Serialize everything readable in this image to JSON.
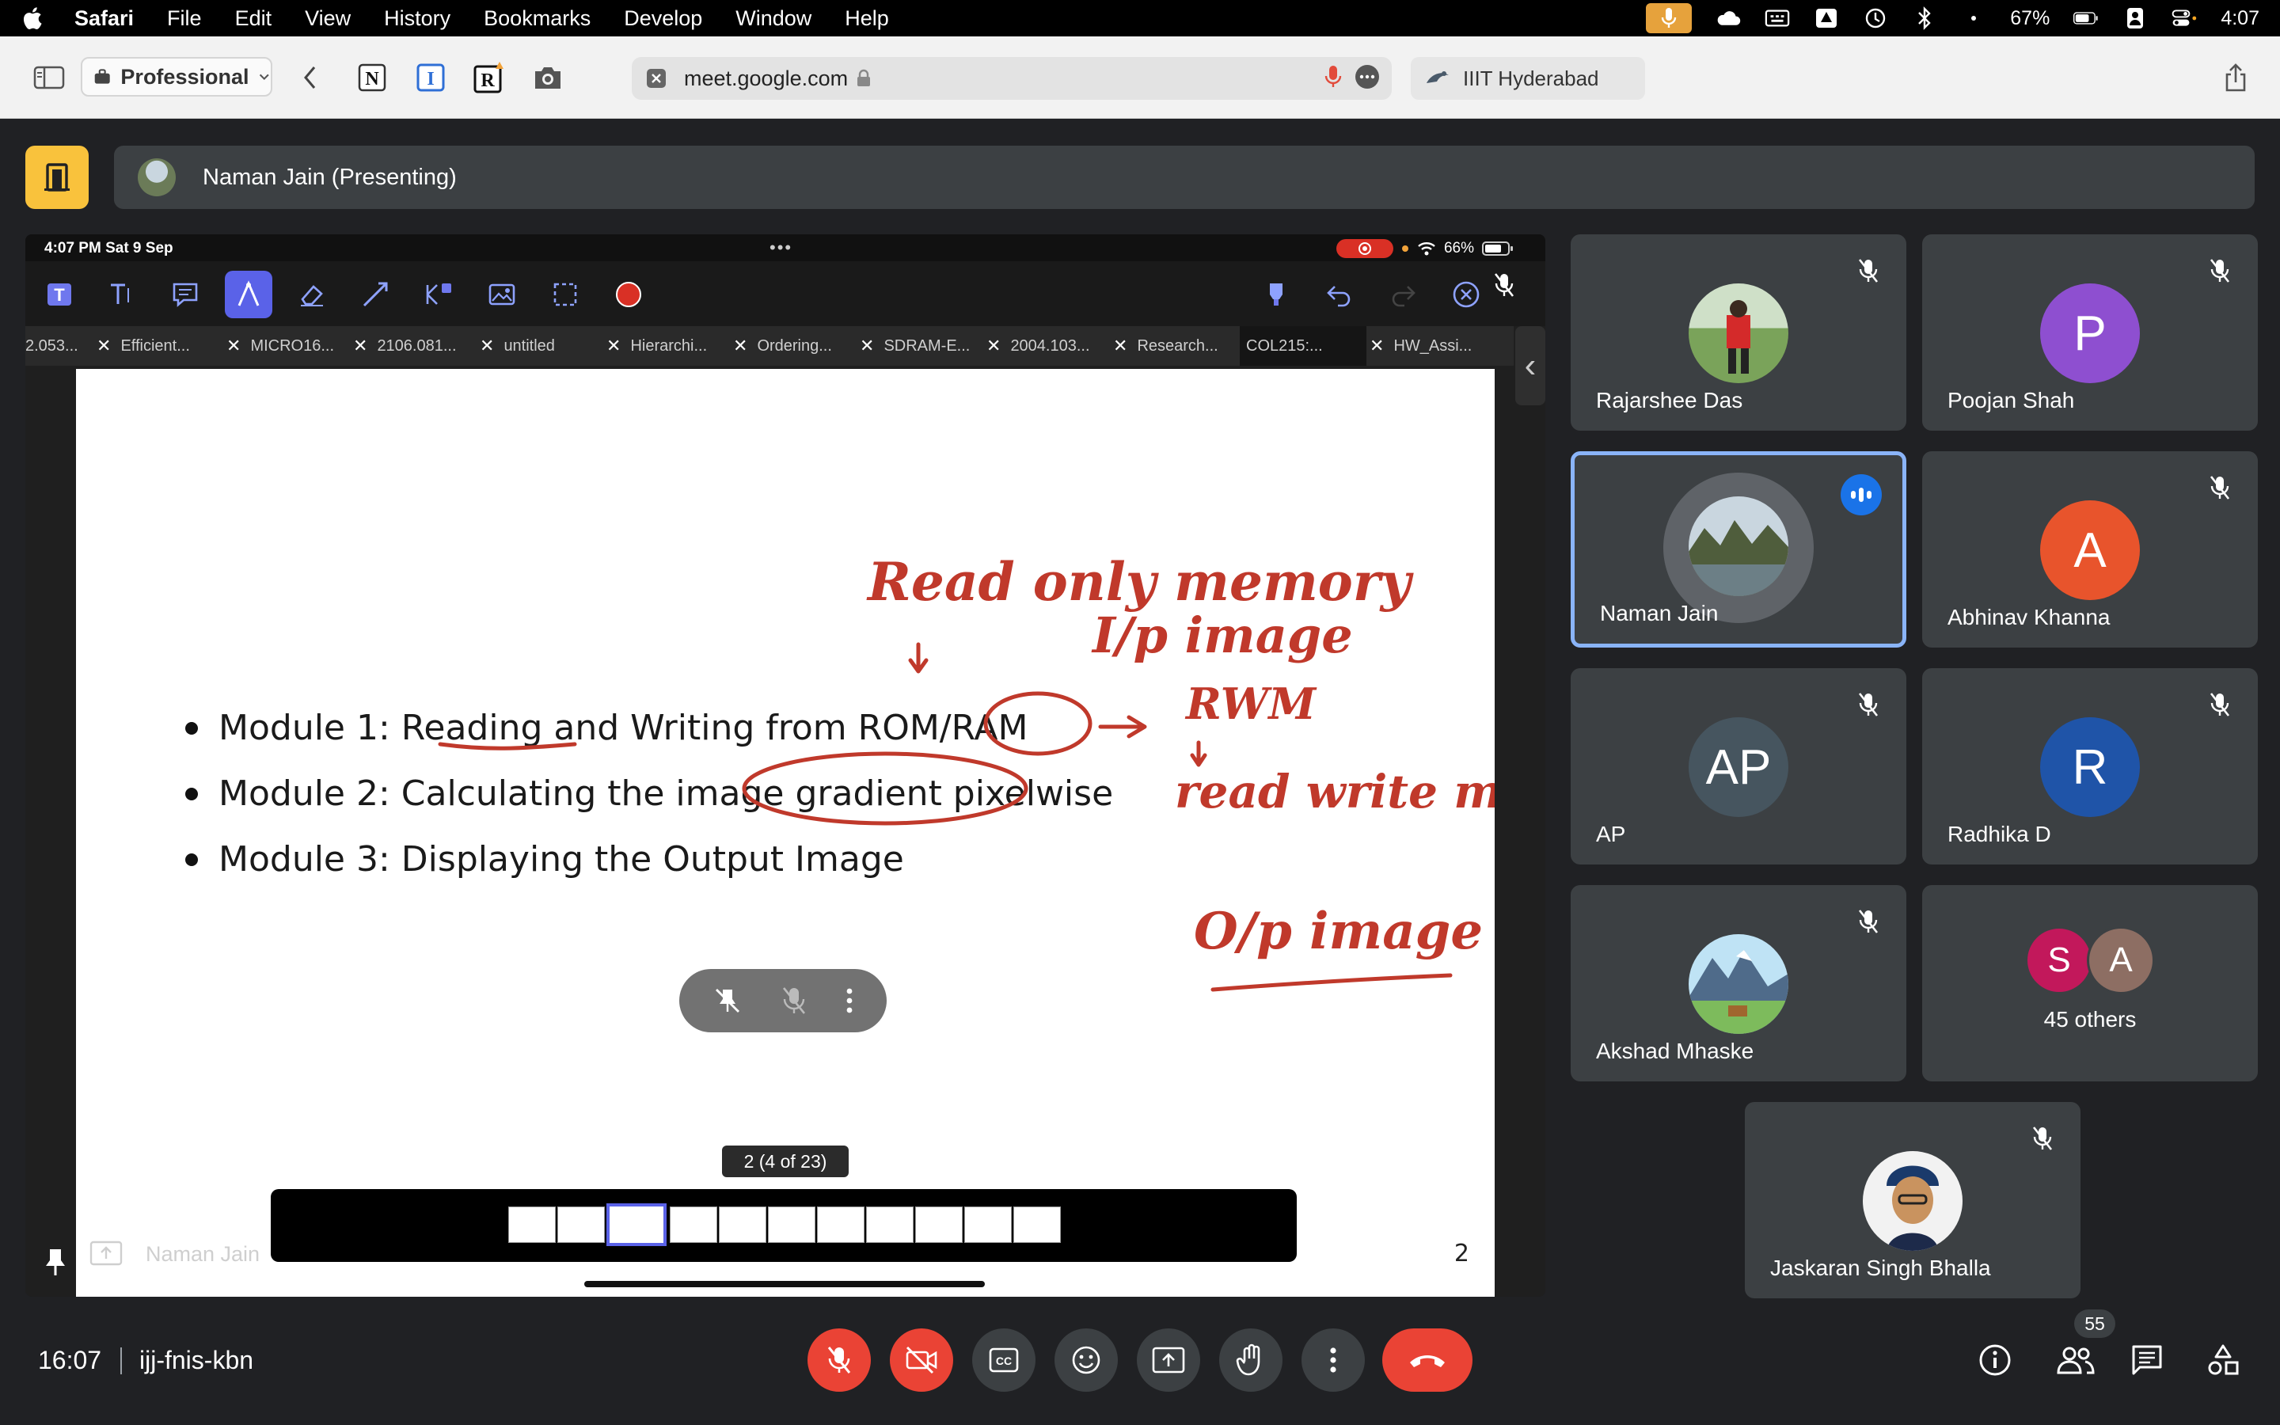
{
  "menubar": {
    "app": "Safari",
    "items": [
      "File",
      "Edit",
      "View",
      "History",
      "Bookmarks",
      "Develop",
      "Window",
      "Help"
    ],
    "battery": "67%",
    "clock": "4:07"
  },
  "safari": {
    "profile": "Professional",
    "url": "meet.google.com",
    "tab_title": "IIIT Hyderabad"
  },
  "meet": {
    "presenting_label": "Naman Jain (Presenting)",
    "meeting_time": "16:07",
    "meeting_code": "ijj-fnis-kbn",
    "people_count": "55",
    "accent": "#8ab4f8",
    "leave_color": "#ea4335"
  },
  "shared_screen": {
    "status_time": "4:07 PM  Sat 9 Sep",
    "status_dots": "•••",
    "battery": "66%",
    "tabs": [
      {
        "label": "2.053..."
      },
      {
        "label": "Efficient..."
      },
      {
        "label": "MICRO16..."
      },
      {
        "label": "2106.081..."
      },
      {
        "label": "untitled"
      },
      {
        "label": "Hierarchi..."
      },
      {
        "label": "Ordering..."
      },
      {
        "label": "SDRAM-E..."
      },
      {
        "label": "2004.103..."
      },
      {
        "label": "Research..."
      },
      {
        "label": "COL215:..."
      },
      {
        "label": "HW_Assi..."
      }
    ],
    "active_tab": "COL215:...",
    "slide": {
      "bullets": [
        "Module 1:  Reading and Writing from ROM/RAM",
        "Module 2:  Calculating the image gradient pixelwise",
        "Module 3:  Displaying the Output Image"
      ],
      "page_number": "2",
      "annotations": [
        "Read only memory",
        "I/p image",
        "RWM",
        "read write memory",
        "O/p image"
      ]
    },
    "page_indicator": "2 (4 of 23)",
    "presenter_name": "Naman Jain",
    "ink_color": "#c0392b"
  },
  "participants": [
    {
      "name": "Rajarshee Das",
      "type": "photo",
      "muted": true
    },
    {
      "name": "Poojan Shah",
      "initial": "P",
      "color": "#8e4fd0",
      "muted": true
    },
    {
      "name": "Naman Jain",
      "type": "photo",
      "speaking": true
    },
    {
      "name": "Abhinav Khanna",
      "initial": "A",
      "color": "#e8542c",
      "muted": true
    },
    {
      "name": "AP",
      "initial": "AP",
      "color": "#46555f",
      "muted": true
    },
    {
      "name": "Radhika D",
      "initial": "R",
      "color": "#1f54a8",
      "muted": true
    },
    {
      "name": "Akshad Mhaske",
      "type": "photo",
      "muted": true
    },
    {
      "others_label": "45 others",
      "initials": [
        "S",
        "A"
      ],
      "colors": [
        "#c2185b",
        "#8d6e63"
      ]
    },
    {
      "name": "Jaskaran Singh Bhalla",
      "type": "photo",
      "muted": true
    }
  ]
}
